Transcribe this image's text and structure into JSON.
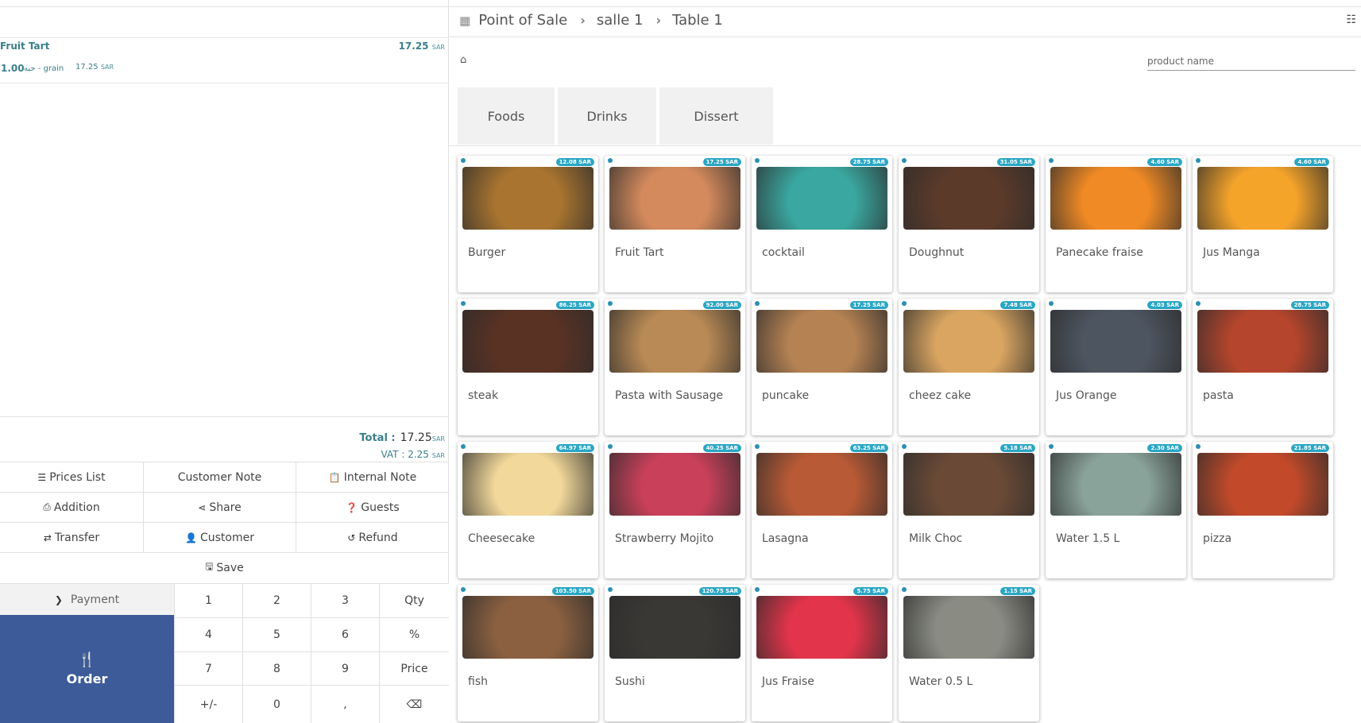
{
  "header": {
    "crumbs": [
      "Point of Sale",
      "salle 1",
      "Table 1"
    ]
  },
  "order": {
    "line": {
      "name": "Fruit Tart",
      "price": "17.25",
      "qty": "1.00",
      "uom": "حبه - grain",
      "unit_price": "17.25"
    },
    "currency": "SAR",
    "total_label": "Total :",
    "total": "17.25",
    "vat_label": "VAT :",
    "vat": "2.25"
  },
  "controls": {
    "prices_list": "Prices List",
    "customer_note": "Customer Note",
    "internal_note": "Internal Note",
    "addition": "Addition",
    "share": "Share",
    "guests": "Guests",
    "transfer": "Transfer",
    "customer": "Customer",
    "refund": "Refund",
    "save": "Save"
  },
  "numpad": {
    "payment": "Payment",
    "order": "Order",
    "keys": [
      "1",
      "2",
      "3",
      "Qty",
      "4",
      "5",
      "6",
      "%",
      "7",
      "8",
      "9",
      "Price",
      "+/-",
      "0",
      ",",
      "⌫"
    ]
  },
  "search": {
    "placeholder": "product name"
  },
  "categories": [
    "Foods",
    "Drinks",
    "Dissert"
  ],
  "products": [
    {
      "name": "Burger",
      "price": "12.08 SAR",
      "color": "#a8742f"
    },
    {
      "name": "Fruit Tart",
      "price": "17.25 SAR",
      "color": "#d48a5c"
    },
    {
      "name": "cocktail",
      "price": "28.75 SAR",
      "color": "#3aa7a0"
    },
    {
      "name": "Doughnut",
      "price": "31.05 SAR",
      "color": "#5b3a2a"
    },
    {
      "name": "Panecake fraise",
      "price": "4.60 SAR",
      "color": "#f08a24"
    },
    {
      "name": "Jus Manga",
      "price": "4.60 SAR",
      "color": "#f5a42a"
    },
    {
      "name": "steak",
      "price": "86.25 SAR",
      "color": "#5a3224"
    },
    {
      "name": "Pasta with Sausage",
      "price": "92.00 SAR",
      "color": "#b98a55"
    },
    {
      "name": "puncake",
      "price": "17.25 SAR",
      "color": "#b58253"
    },
    {
      "name": "cheez cake",
      "price": "7.48 SAR",
      "color": "#d9a560"
    },
    {
      "name": "Jus Orange",
      "price": "4.03 SAR",
      "color": "#4d5560"
    },
    {
      "name": "pasta",
      "price": "28.75 SAR",
      "color": "#b5452c"
    },
    {
      "name": "Cheesecake",
      "price": "64.97 SAR",
      "color": "#f2d89a"
    },
    {
      "name": "Strawberry Mojito",
      "price": "40.25 SAR",
      "color": "#c9405a"
    },
    {
      "name": "Lasagna",
      "price": "63.25 SAR",
      "color": "#b85a35"
    },
    {
      "name": "Milk Choc",
      "price": "5.18 SAR",
      "color": "#6a4a36"
    },
    {
      "name": "Water 1.5 L",
      "price": "2.30 SAR",
      "color": "#8aa39a"
    },
    {
      "name": "pizza",
      "price": "21.85 SAR",
      "color": "#c24a2a"
    },
    {
      "name": "fish",
      "price": "103.50 SAR",
      "color": "#8a6040"
    },
    {
      "name": "Sushi",
      "price": "120.75 SAR",
      "color": "#3a3835"
    },
    {
      "name": "Jus Fraise",
      "price": "5.75 SAR",
      "color": "#e2344a"
    },
    {
      "name": "Water 0.5 L",
      "price": "1.15 SAR",
      "color": "#8a8c84"
    }
  ]
}
